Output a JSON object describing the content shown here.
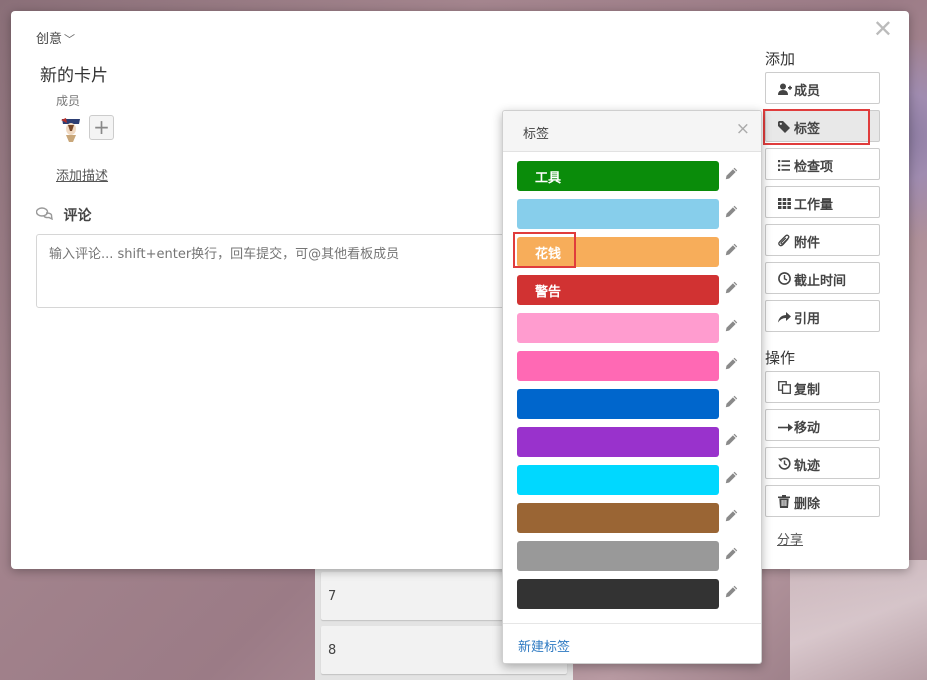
{
  "background": {
    "cards": [
      "7",
      "8"
    ]
  },
  "dialog": {
    "list_name": "创意",
    "list_chevron": "﹀",
    "card_title": "新的卡片",
    "members_label": "成员",
    "add_member_symbol": "+",
    "add_description": "添加描述",
    "comment_title": "评论",
    "comment_placeholder": "输入评论... shift+enter换行，回车提交，可@其他看板成员",
    "close_symbol": "✕"
  },
  "sidebar": {
    "add_title": "添加",
    "add_buttons": [
      {
        "label": "成员",
        "icon": "add-user-icon"
      },
      {
        "label": "标签",
        "icon": "tag-icon"
      },
      {
        "label": "检查项",
        "icon": "checklist-icon"
      },
      {
        "label": "工作量",
        "icon": "grid-icon"
      },
      {
        "label": "附件",
        "icon": "paperclip-icon"
      },
      {
        "label": "截止时间",
        "icon": "clock-icon"
      },
      {
        "label": "引用",
        "icon": "share-arrow-icon"
      }
    ],
    "actions_title": "操作",
    "action_buttons": [
      {
        "label": "复制",
        "icon": "copy-icon"
      },
      {
        "label": "移动",
        "icon": "arrow-right-icon"
      },
      {
        "label": "轨迹",
        "icon": "history-icon"
      },
      {
        "label": "删除",
        "icon": "trash-icon"
      }
    ],
    "share_label": "分享"
  },
  "popover": {
    "title": "标签",
    "close_symbol": "×",
    "labels": [
      {
        "text": "工具",
        "color": "#0a8c0a"
      },
      {
        "text": "",
        "color": "#87ceeb"
      },
      {
        "text": "花钱",
        "color": "#f7ad5a"
      },
      {
        "text": "警告",
        "color": "#d13232"
      },
      {
        "text": "",
        "color": "#ff9ccf"
      },
      {
        "text": "",
        "color": "#ff69b4"
      },
      {
        "text": "",
        "color": "#0066cc"
      },
      {
        "text": "",
        "color": "#9932cc"
      },
      {
        "text": "",
        "color": "#00d8ff"
      },
      {
        "text": "",
        "color": "#9a6534"
      },
      {
        "text": "",
        "color": "#999999"
      },
      {
        "text": "",
        "color": "#333333"
      }
    ],
    "new_label": "新建标签"
  }
}
